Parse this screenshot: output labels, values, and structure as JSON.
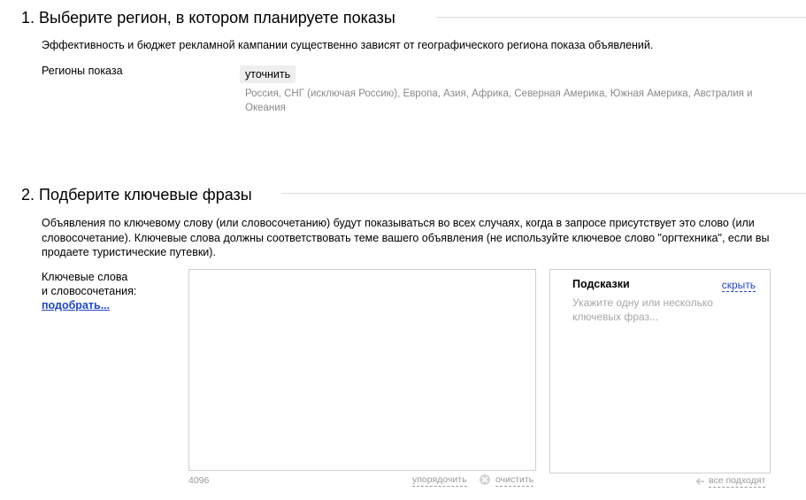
{
  "section1": {
    "title": "1. Выберите регион, в котором планируете показы",
    "description": "Эффективность и бюджет рекламной кампании существенно зависят от географического региона показа объявлений.",
    "regions_label": "Регионы показа",
    "refine_button": "уточнить",
    "regions_list": "Россия, СНГ (исключая Россию), Европа, Азия, Африка, Северная Америка, Южная Америка, Австралия и Океания"
  },
  "section2": {
    "title": "2. Подберите ключевые фразы",
    "description": "Объявления по ключевому слову (или словосочетанию) будут показываться во всех случаях, когда в запросе присутствует это слово (или словосочетание). Ключевые слова должны соответствовать теме вашего объявления (не используйте ключевое слово \"оргтехника\", если вы продаете туристические путевки).",
    "keywords_label_line1": "Ключевые слова",
    "keywords_label_line2": "и словосочетания:",
    "pick_link": "подобрать...",
    "keywords_value": "",
    "char_counter": "4096",
    "sort_link": "упорядочить",
    "clear_link": "очистить",
    "hints": {
      "title": "Подсказки",
      "hide_link": "скрыть",
      "text": "Укажите одну или несколько ключевых фраз...",
      "all_fit_link": "все подходят"
    }
  },
  "colors": {
    "link_blue": "#1f47c9",
    "muted_text": "#8a8a8a",
    "border": "#cfcfcf",
    "button_bg": "#eeeeee"
  },
  "icons": {
    "clear": "circle-x-icon",
    "all_fit": "arrow-left-icon",
    "resize": "resize-grip-icon"
  }
}
